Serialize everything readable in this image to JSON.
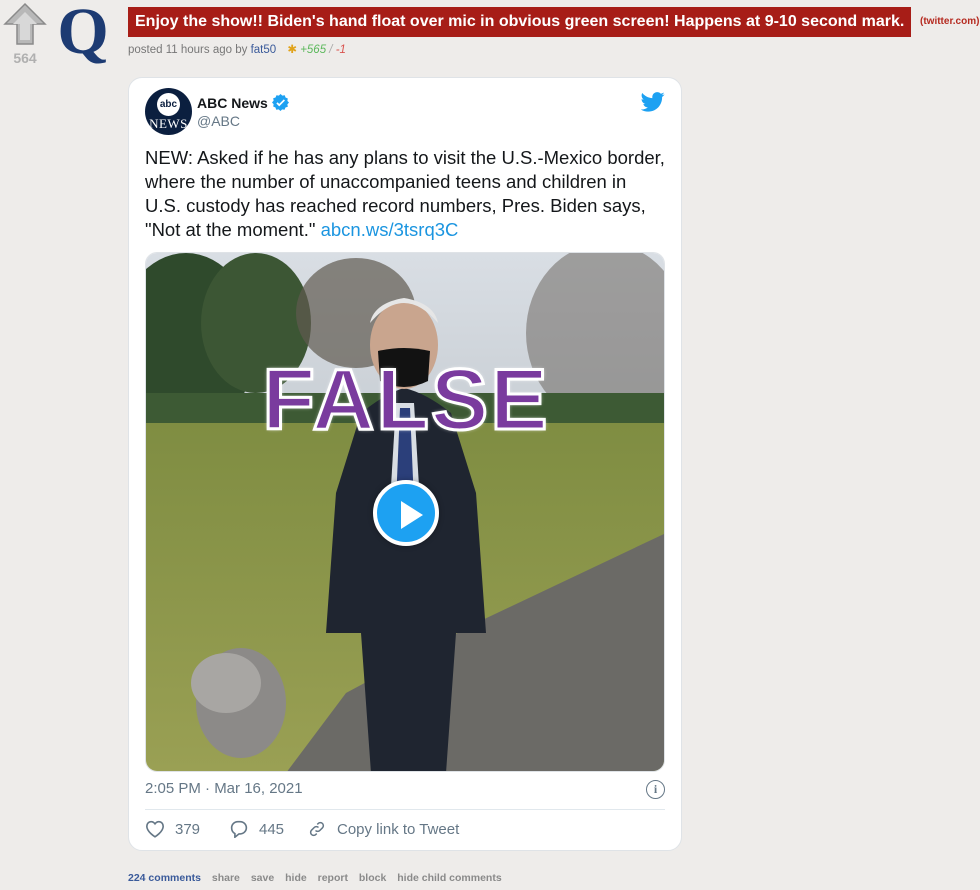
{
  "post": {
    "score": "564",
    "title": "Enjoy the show!! Biden's hand float over mic in obvious green screen! Happens at 9-10 second mark.",
    "domain": "(twitter.com)",
    "tagline": {
      "prefix": "posted 11 hours ago by",
      "author": "fat50",
      "upvotes": "+565",
      "separator": "/",
      "downvotes": "-1"
    },
    "links": {
      "comments": "224 comments",
      "share": "share",
      "save": "save",
      "hide": "hide",
      "report": "report",
      "block": "block",
      "hide_child": "hide child comments"
    }
  },
  "tweet": {
    "avatar_top": "abc",
    "avatar_bottom": "NEWS",
    "name": "ABC News",
    "handle": "@ABC",
    "text": "NEW: Asked if he has any plans to visit the U.S.-Mexico border, where the number of unaccompanied teens and children in U.S. custody has reached record numbers, Pres. Biden says, \"Not at the moment.\"",
    "link": "abcn.ws/3tsrq3C",
    "overlay_stamp": "FALSE",
    "timestamp": "2:05 PM · Mar 16, 2021",
    "likes": "379",
    "replies": "445",
    "copy_link": "Copy link to Tweet"
  },
  "icons": [
    "upvote-arrow-icon",
    "q-logo-icon",
    "verified-badge-icon",
    "twitter-bird-icon",
    "play-icon",
    "info-icon",
    "heart-icon",
    "reply-icon",
    "link-icon"
  ],
  "colors": {
    "title_bg": "#a71d17",
    "stamp": "#7a3b9e",
    "twitter_blue": "#1da1f2",
    "page_bg": "#eeecea"
  }
}
